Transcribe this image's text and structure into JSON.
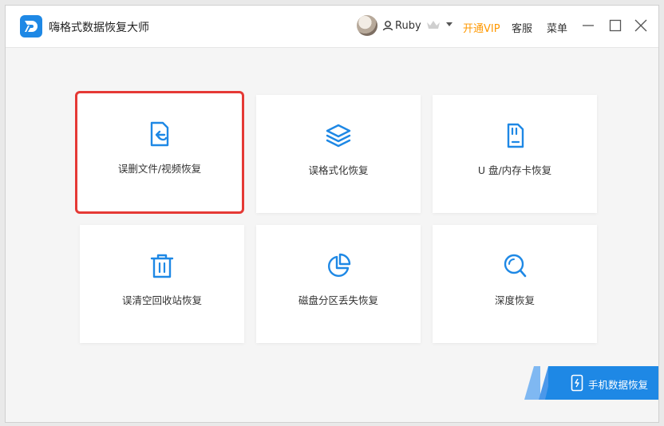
{
  "app": {
    "title": "嗨格式数据恢复大师",
    "accent_color": "#1e88e5"
  },
  "header": {
    "user_name": "Ruby",
    "vip_label": "开通VIP",
    "service_label": "客服",
    "menu_label": "菜单",
    "vip_color": "#ff9800"
  },
  "cards": [
    {
      "label": "误删文件/视频恢复",
      "icon": "file-recover-icon",
      "selected": true
    },
    {
      "label": "误格式化恢复",
      "icon": "layers-icon"
    },
    {
      "label": "U 盘/内存卡恢复",
      "icon": "sd-card-icon"
    },
    {
      "label": "误清空回收站恢复",
      "icon": "trash-icon"
    },
    {
      "label": "磁盘分区丢失恢复",
      "icon": "pie-chart-icon"
    },
    {
      "label": "深度恢复",
      "icon": "magnifier-icon"
    }
  ],
  "phone_banner": {
    "label": "手机数据恢复",
    "icon": "phone-icon"
  },
  "selection_color": "#e53935"
}
